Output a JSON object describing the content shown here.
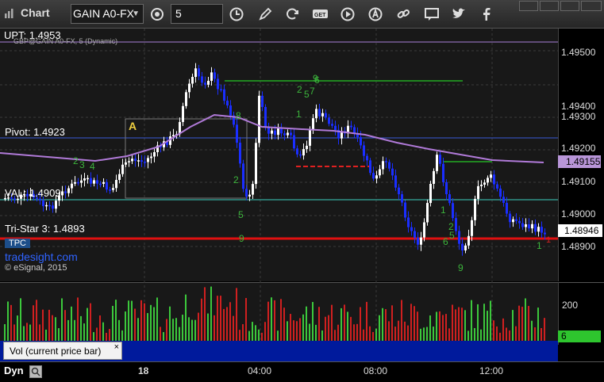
{
  "toolbar": {
    "title": "Chart",
    "symbol": "GAIN A0-FX",
    "interval": "5",
    "icons": [
      "timezone-icon",
      "clock-icon",
      "pencil-icon",
      "refresh-icon",
      "get-icon",
      "play-icon",
      "alert-icon",
      "link-icon",
      "comment-icon",
      "twitter-icon",
      "facebook-icon"
    ]
  },
  "chart": {
    "upt_label": "UPT: 1.4953",
    "moving_avg_label": "GBP@GAIN A0-FX, 5 (Dynamic)",
    "pivot_label": "Pivot: 1.4923",
    "val_label": "VAL: 1.4909",
    "tristar_label": "Tri-Star 3: 1.4893",
    "tpc_label": "TPC",
    "brand": "tradesight.com",
    "copyright": "© eSignal, 2015",
    "a_marker": "A",
    "ma_price_badge": "1.49155",
    "last_price_badge": "1.48946",
    "price_ticks": [
      "1.49500",
      "1.49400",
      "1.49300",
      "1.49200",
      "1.49100",
      "1.49000",
      "1.48900"
    ],
    "seq_numbers": [
      "9",
      "2",
      "5",
      "7",
      "6",
      "1",
      "2",
      "3",
      "4",
      "5",
      "1",
      "2",
      "9",
      "8",
      "2",
      "1",
      "5",
      "6",
      "9",
      "1"
    ]
  },
  "volume": {
    "label": "Vol (current price bar)",
    "close_icon": "×",
    "tick": "200",
    "badge": "6"
  },
  "time_axis": {
    "mode": "Dyn",
    "ticks": [
      "18",
      "04:00",
      "08:00",
      "12:00"
    ]
  },
  "colors": {
    "candle_up": "#ffffff",
    "candle_down": "#1a2eff",
    "vol_up": "#3cc83c",
    "vol_down": "#d02020",
    "ma": "#b07ad8",
    "pivot": "#3a5ad8",
    "val": "#3cd0c0",
    "tristar": "#e01010",
    "badge_green": "#2ec52e"
  }
}
